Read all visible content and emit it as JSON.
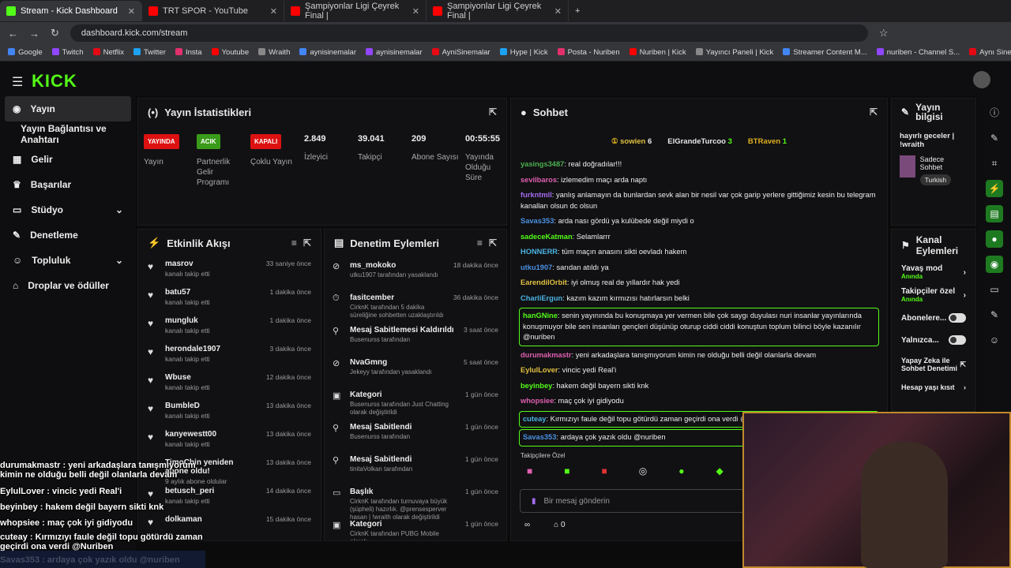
{
  "browser": {
    "tabs": [
      "Stream - Kick Dashboard",
      "TRT SPOR - YouTube",
      "Şampiyonlar Ligi Çeyrek Final |",
      "Şampiyonlar Ligi Çeyrek Final |"
    ],
    "url": "dashboard.kick.com/stream",
    "bookmarks": [
      "Google",
      "Twitch",
      "Netflix",
      "Twitter",
      "Insta",
      "Youtube",
      "Wraith",
      "aynisinemalar",
      "aynisinemalar",
      "AyniSinemalar",
      "Hype | Kick",
      "Posta - Nuriben",
      "Nuriben | Kick",
      "Yayıncı Paneli | Kick",
      "Streamer Content M...",
      "nuriben - Channel S...",
      "Aynı Sinemalar - Ça..."
    ]
  },
  "logo": "KICK",
  "sidebar": {
    "items": [
      "Yayın",
      "Yayın Bağlantısı ve Anahtarı",
      "Gelir",
      "Başarılar",
      "Stüdyo",
      "Denetleme",
      "Topluluk",
      "Droplar ve ödüller"
    ]
  },
  "stats": {
    "title": "Yayın İstatistikleri",
    "live": "YAYINDA",
    "live_label": "Yayın",
    "partner": "ACIK",
    "partner_label": "Partnerlik Gelir Programı",
    "multi": "KAPALI",
    "multi_label": "Çoklu Yayın",
    "viewers": "2.849",
    "viewers_label": "İzleyici",
    "followers": "39.041",
    "followers_label": "Takipçi",
    "subs": "209",
    "subs_label": "Abone Sayısı",
    "uptime": "00:55:55",
    "uptime_label": "Yayında Olduğu Süre"
  },
  "activity": {
    "title": "Etkinlik Akışı",
    "rows": [
      {
        "n": "masrov",
        "s": "kanalı takip etti",
        "t": "33 saniye önce"
      },
      {
        "n": "batu57",
        "s": "kanalı takip etti",
        "t": "1 dakika önce"
      },
      {
        "n": "mungluk",
        "s": "kanalı takip etti",
        "t": "1 dakika önce"
      },
      {
        "n": "herondale1907",
        "s": "kanalı takip etti",
        "t": "3 dakika önce"
      },
      {
        "n": "Wbuse",
        "s": "kanalı takip etti",
        "t": "12 dakika önce"
      },
      {
        "n": "BumbleD",
        "s": "kanalı takip etti",
        "t": "13 dakika önce"
      },
      {
        "n": "kanyewestt00",
        "s": "kanalı takip etti",
        "t": "13 dakika önce"
      },
      {
        "n": "TimoChin yeniden abone oldu!",
        "s": "9 aylık abone oldular",
        "t": "13 dakika önce"
      },
      {
        "n": "betusch_peri",
        "s": "kanalı takip etti",
        "t": "14 dakika önce"
      },
      {
        "n": "dolkaman",
        "s": "",
        "t": "15 dakika önce"
      }
    ]
  },
  "moderation": {
    "title": "Denetim Eylemleri",
    "rows": [
      {
        "n": "ms_mokoko",
        "s": "utku1907 tarafından yasaklandı",
        "t": "18 dakika önce"
      },
      {
        "n": "fasitcember",
        "s": "CirknK tarafından 5 dakika süreliğine sohbetten uzaklaştırıldı",
        "t": "36 dakika önce"
      },
      {
        "n": "Mesaj Sabitlemesi Kaldırıldı",
        "s": "Busenurss tarafından",
        "t": "3 saat önce"
      },
      {
        "n": "NvaGmng",
        "s": "Jekeyy tarafından yasaklandı",
        "t": "5 saat önce"
      },
      {
        "n": "Kategori",
        "s": "Busenurss tarafından Just Chatting olarak değiştirildi",
        "t": "1 gün önce"
      },
      {
        "n": "Mesaj Sabitlendi",
        "s": "Busenurss tarafından",
        "t": "1 gün önce"
      },
      {
        "n": "Mesaj Sabitlendi",
        "s": "tinitaVolkan tarafından",
        "t": "1 gün önce"
      },
      {
        "n": "Başlık",
        "s": "CirknK tarafından turnuvaya büyük (şüpheli) hazırlık. @prensesperver hasan | !wraith olarak değiştirildi",
        "t": "1 gün önce"
      },
      {
        "n": "Kategori",
        "s": "CirknK tarafından PUBG Mobile olarak",
        "t": "1 gün önce"
      }
    ]
  },
  "chat": {
    "title": "Sohbet",
    "top": [
      {
        "n": "sowien",
        "v": "6"
      },
      {
        "n": "ElGrandeTurcoo",
        "v": "3"
      },
      {
        "n": "BTRaven",
        "v": "1"
      }
    ],
    "messages": [
      {
        "u": "yasings3487",
        "c": "#4caf50",
        "m": "real doğradılar!!!"
      },
      {
        "u": "sevilbaros",
        "c": "#e05fb0",
        "m": "izlemedim maçı arda naptı"
      },
      {
        "u": "furkntmll",
        "c": "#a56cf0",
        "m": "yanlış anlamayın da bunlardan sevk alan bir nesil var çok garip yerlere gittiğimiz kesin bu telegram kanalları olsun dc olsun"
      },
      {
        "u": "Savas353",
        "c": "#4a90e2",
        "m": "arda nası gördü ya kulübede değil miydi o"
      },
      {
        "u": "sadeceKatman",
        "c": "#53fc18",
        "m": "Selamlarrr"
      },
      {
        "u": "HONNERR",
        "c": "#4ab3e2",
        "m": "tüm maçın anasını sikti oevladı hakem"
      },
      {
        "u": "utku1907",
        "c": "#4a90e2",
        "m": "sarıdan atıldı ya"
      },
      {
        "u": "EarendilOrbit",
        "c": "#e0c040",
        "m": "iyi olmuş real de yıllardır hak yedi"
      },
      {
        "u": "CharliErgun",
        "c": "#4ab3e2",
        "m": "kazım kazım kırmızısı hatırlarsın belki"
      },
      {
        "u": "hanGNine",
        "c": "#53fc18",
        "m": "senin yayınında bu konuşmaya yer vermen bile çok saygı duyulası nuri insanlar yayınlarında konuşmuyor bile sen insanları gençleri düşünüp oturup ciddi ciddi konuştun toplum bilinci böyle kazanılır @nuriben"
      },
      {
        "u": "durumakmastr",
        "c": "#e05fb0",
        "m": "yeni arkadaşlara tanışmıyorum kimin ne olduğu belli değil olanlarla devam"
      },
      {
        "u": "EylulLover",
        "c": "#e0c040",
        "m": "vincic yedi Real'i"
      },
      {
        "u": "beyinbey",
        "c": "#53fc18",
        "m": "hakem değil bayern sikti knk"
      },
      {
        "u": "whopsiee",
        "c": "#e05fb0",
        "m": "maç çok iyi gidiyodu"
      },
      {
        "u": "cuteay",
        "c": "#4ab3e2",
        "m": "Kırmızıyı faule değil topu götürdü zaman geçirdi ona verdi @"
      },
      {
        "u": "Savas353",
        "c": "#4a90e2",
        "m": "ardaya çok yazık oldu @nuriben"
      }
    ],
    "follower_only": "Takipçilere Özel",
    "placeholder": "Bir mesaj gönderin",
    "count": "0"
  },
  "info": {
    "title": "Yayın bilgisi",
    "stream_title": "hayırlı geceler | !wraith",
    "category": "Sadece Sohbet",
    "tag": "Turkish"
  },
  "channel": {
    "title": "Kanal Eylemleri",
    "slow": "Yavaş mod",
    "slow_sub": "Anında",
    "follow": "Takipçiler özel",
    "follow_sub": "Anında",
    "subs": "Abonelere...",
    "only": "Yalnızca...",
    "ai": "Yapay Zeka ile Sohbet Denetimi",
    "age": "Hesap yaşı kısıt"
  },
  "overlay": [
    "durumakmastr : yeni arkadaşlara tanışmıyorum kimin ne olduğu belli değil olanlarla devam",
    "EylulLover : vincic yedi Real'i",
    "beyinbey : hakem değil bayern sikti knk",
    "whopsiee : maç çok iyi gidiyodu",
    "cuteay : Kırmızıyı faule değil topu götürdü zaman geçirdi ona verdi @Nuriben",
    "Savas353 : ardaya çok yazık oldu @nuriben"
  ]
}
